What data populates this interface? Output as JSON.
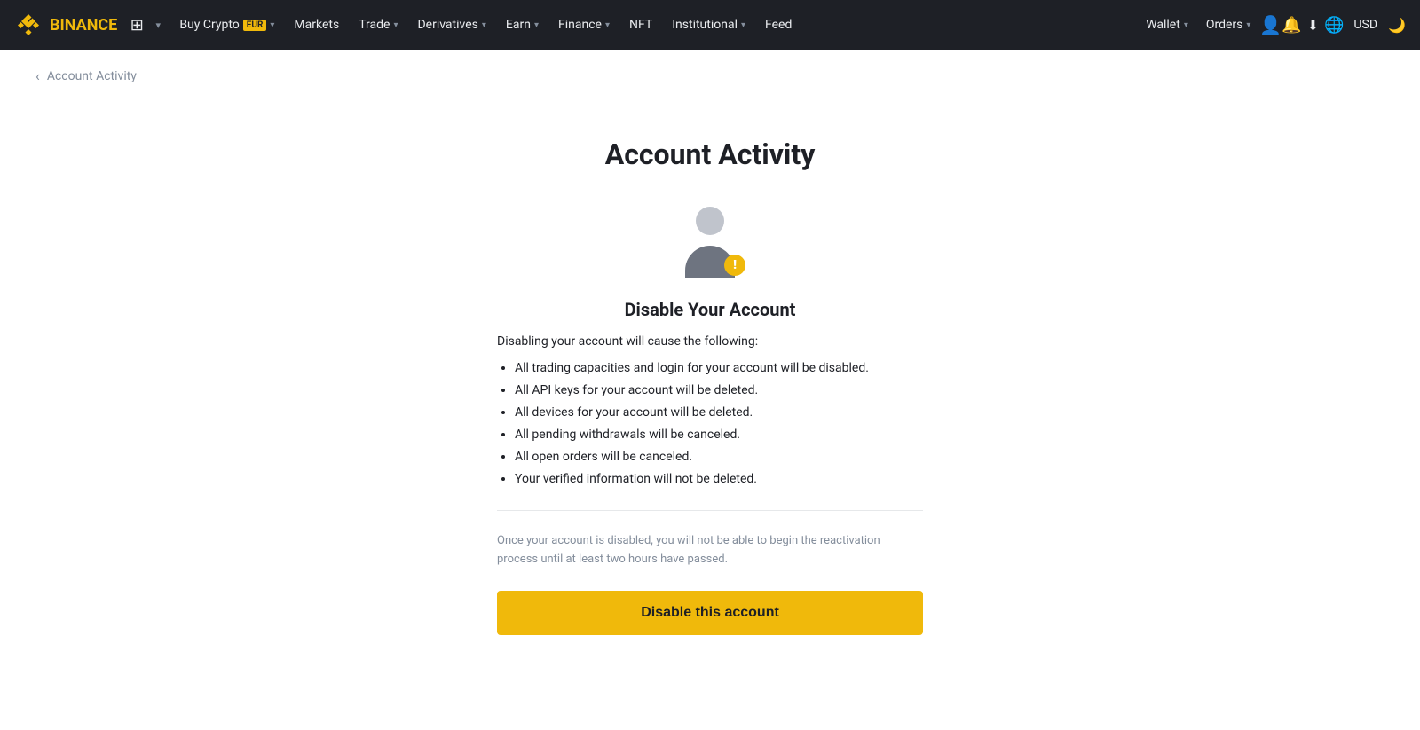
{
  "nav": {
    "logo_text": "BINANCE",
    "items": [
      {
        "label": "Buy Crypto",
        "badge": "EUR",
        "has_dropdown": true
      },
      {
        "label": "Markets",
        "has_dropdown": false
      },
      {
        "label": "Trade",
        "has_dropdown": true
      },
      {
        "label": "Derivatives",
        "has_dropdown": true
      },
      {
        "label": "Earn",
        "has_dropdown": true
      },
      {
        "label": "Finance",
        "has_dropdown": true
      },
      {
        "label": "NFT",
        "has_dropdown": false
      },
      {
        "label": "Institutional",
        "has_dropdown": true
      },
      {
        "label": "Feed",
        "has_dropdown": false
      }
    ],
    "right_items": [
      {
        "label": "Wallet",
        "has_dropdown": true
      },
      {
        "label": "Orders",
        "has_dropdown": true
      }
    ],
    "currency": "USD"
  },
  "breadcrumb": {
    "back_label": "‹",
    "text": "Account Activity"
  },
  "page": {
    "title": "Account Activity",
    "content_title": "Disable Your Account",
    "intro": "Disabling your account will cause the following:",
    "list_items": [
      "All trading capacities and login for your account will be disabled.",
      "All API keys for your account will be deleted.",
      "All devices for your account will be deleted.",
      "All pending withdrawals will be canceled.",
      "All open orders will be canceled.",
      "Your verified information will not be deleted."
    ],
    "note": "Once your account is disabled, you will not be able to begin the reactivation process until at least two hours have passed.",
    "disable_button": "Disable this account"
  }
}
